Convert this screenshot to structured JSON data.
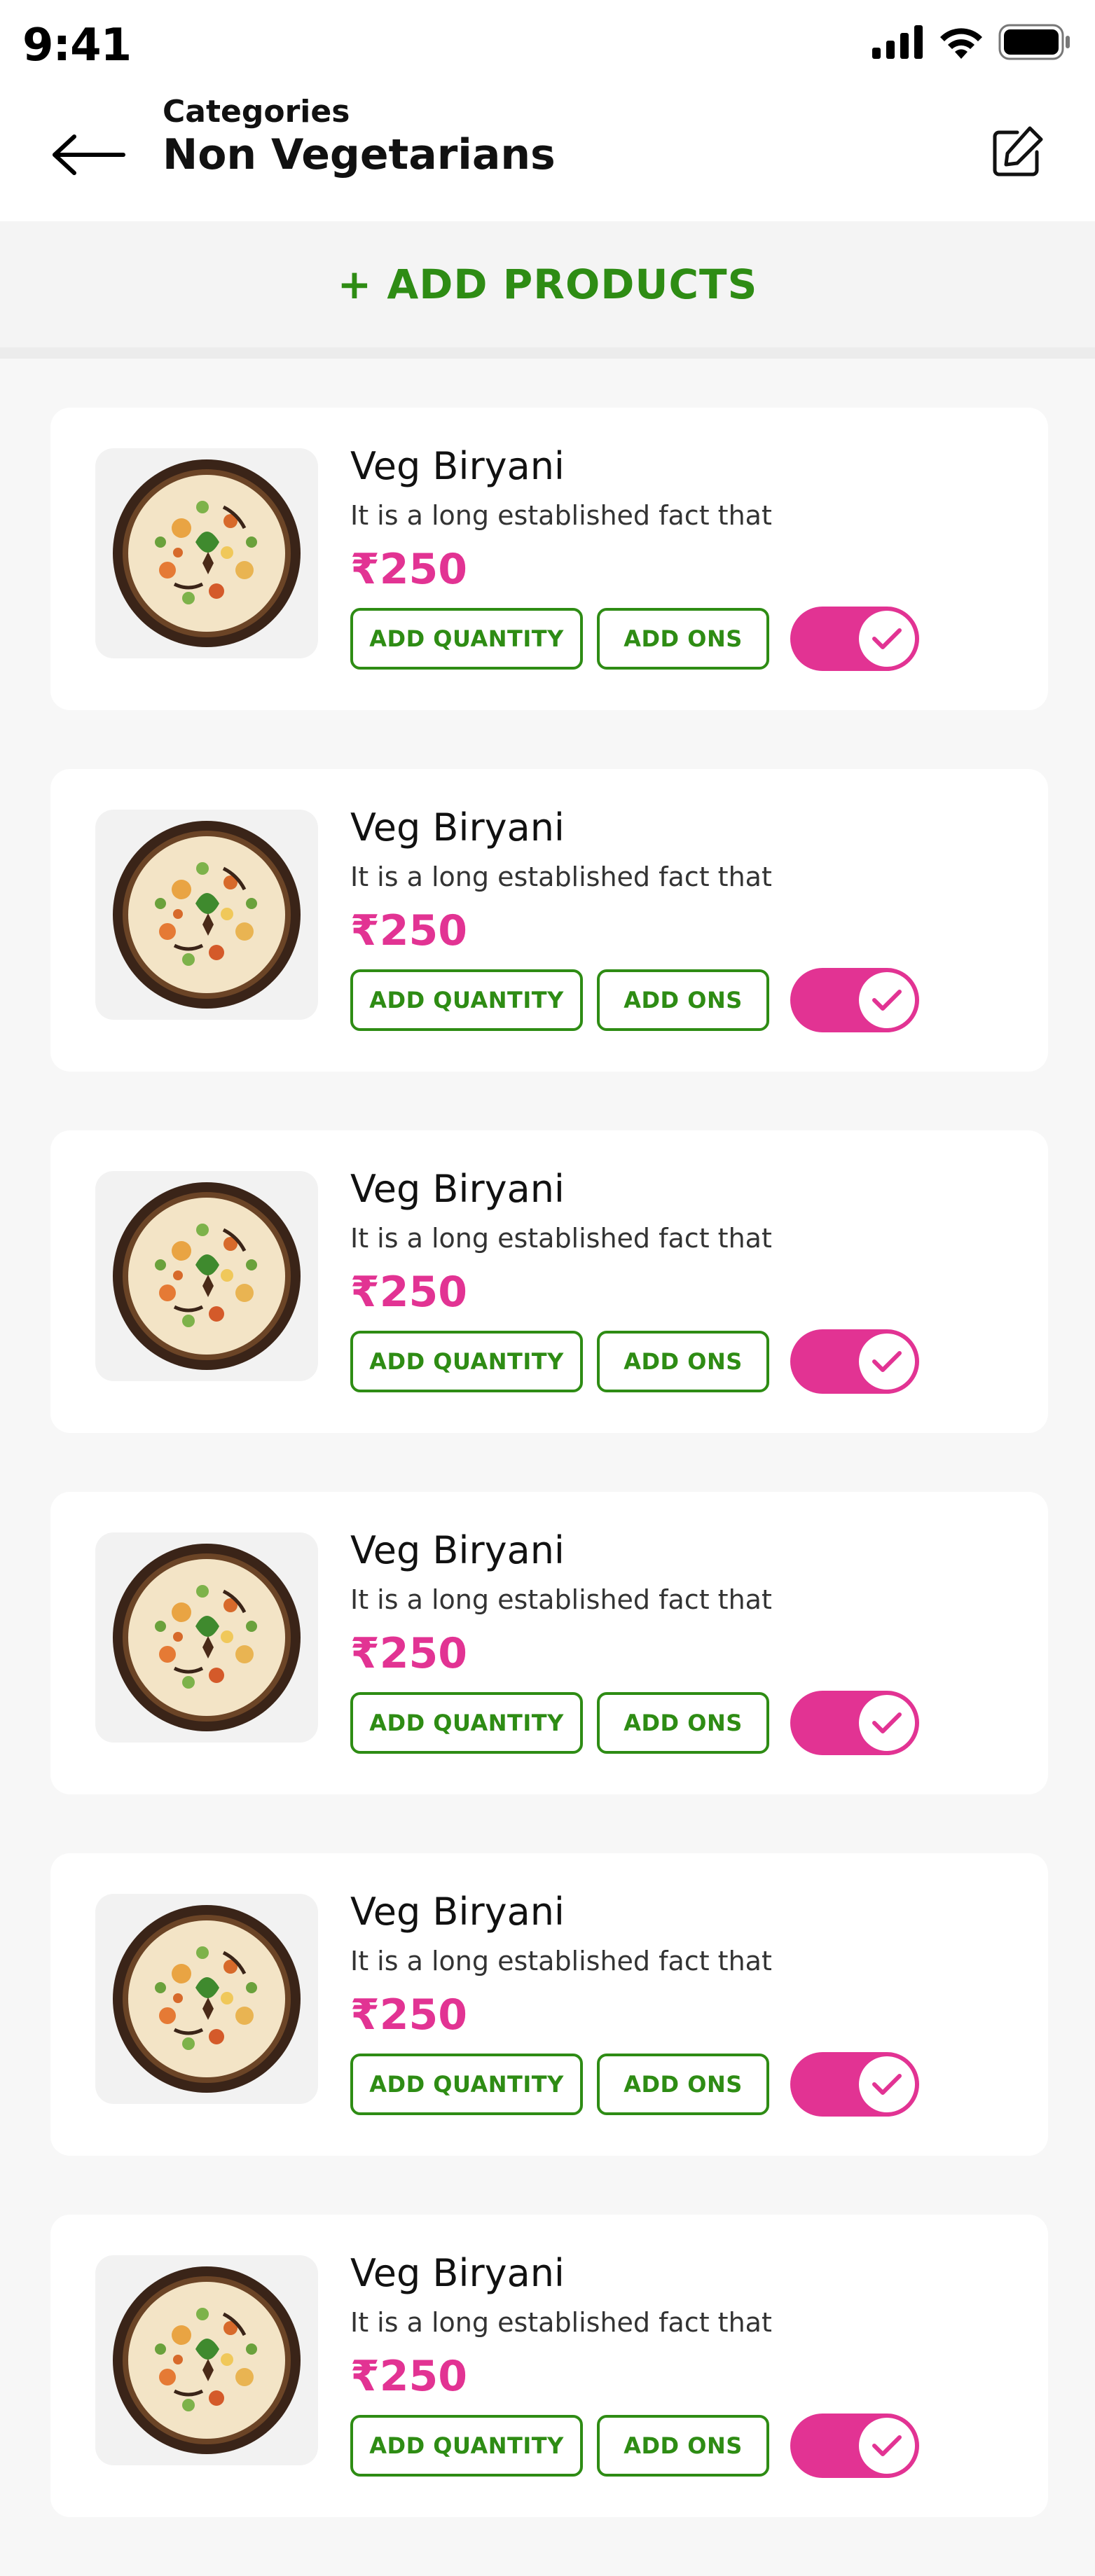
{
  "status_bar": {
    "time": "9:41"
  },
  "header": {
    "subtitle": "Categories",
    "title": "Non Vegetarians"
  },
  "actions": {
    "add_products_label": "+ ADD PRODUCTS"
  },
  "colors": {
    "accent_green": "#2e8c14",
    "accent_pink": "#e23393"
  },
  "products": [
    {
      "name": "Veg Biryani",
      "description": "It is a long established fact that",
      "price": "₹250",
      "add_quantity_label": "ADD QUANTITY",
      "add_ons_label": "ADD ONS",
      "enabled": true
    },
    {
      "name": "Veg Biryani",
      "description": "It is a long established fact that",
      "price": "₹250",
      "add_quantity_label": "ADD QUANTITY",
      "add_ons_label": "ADD ONS",
      "enabled": true
    },
    {
      "name": "Veg Biryani",
      "description": "It is a long established fact that",
      "price": "₹250",
      "add_quantity_label": "ADD QUANTITY",
      "add_ons_label": "ADD ONS",
      "enabled": true
    },
    {
      "name": "Veg Biryani",
      "description": "It is a long established fact that",
      "price": "₹250",
      "add_quantity_label": "ADD QUANTITY",
      "add_ons_label": "ADD ONS",
      "enabled": true
    },
    {
      "name": "Veg Biryani",
      "description": "It is a long established fact that",
      "price": "₹250",
      "add_quantity_label": "ADD QUANTITY",
      "add_ons_label": "ADD ONS",
      "enabled": true
    },
    {
      "name": "Veg Biryani",
      "description": "It is a long established fact that",
      "price": "₹250",
      "add_quantity_label": "ADD QUANTITY",
      "add_ons_label": "ADD ONS",
      "enabled": true
    }
  ]
}
